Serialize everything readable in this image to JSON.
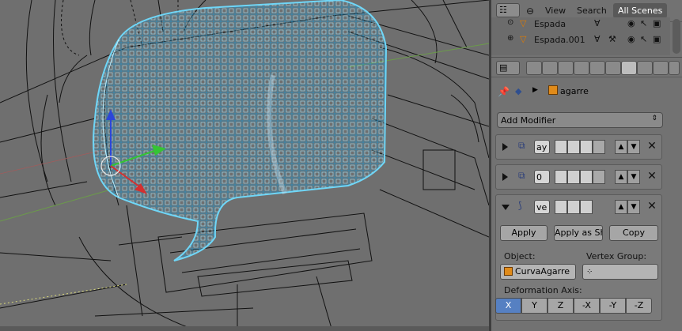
{
  "outliner": {
    "view_label": "View",
    "search_label": "Search",
    "scene_filter": "All Scenes",
    "items": [
      {
        "name": "Espada"
      },
      {
        "name": "Espada.001"
      }
    ]
  },
  "properties": {
    "object_name": "agarre",
    "add_modifier_label": "Add Modifier",
    "modifiers": [
      {
        "name": "ay",
        "expanded": false
      },
      {
        "name": "0",
        "expanded": false
      },
      {
        "name": "ve",
        "expanded": true
      }
    ],
    "curve_modifier": {
      "apply_label": "Apply",
      "apply_as_label": "Apply as Sh",
      "copy_label": "Copy",
      "object_label": "Object:",
      "object_value": "CurvaAgarre",
      "vertex_group_label": "Vertex Group:",
      "vertex_group_value": "",
      "deformation_axis_label": "Deformation Axis:",
      "axes": [
        "X",
        "Y",
        "Z",
        "-X",
        "-Y",
        "-Z"
      ],
      "selected_axis": "X"
    }
  },
  "colors": {
    "selection_wire": "#6fd6f7",
    "axis_selected": "#5680c2",
    "viewport_bg": "#6f6f6f"
  }
}
